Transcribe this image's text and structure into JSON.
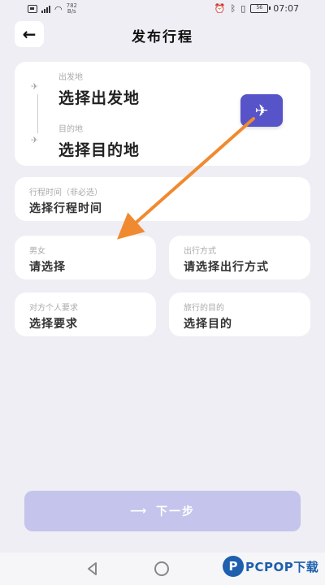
{
  "status_bar": {
    "network_speed": "782\nB/s",
    "time": "07:07",
    "battery": "56"
  },
  "header": {
    "back_glyph": "←",
    "title": "发布行程"
  },
  "route": {
    "from_label": "出发地",
    "from_value": "选择出发地",
    "to_label": "目的地",
    "to_value": "选择目的地"
  },
  "time": {
    "label": "行程时间（非必选）",
    "value": "选择行程时间"
  },
  "gender": {
    "label": "男女",
    "value": "请选择"
  },
  "travel_mode": {
    "label": "出行方式",
    "value": "请选择出行方式"
  },
  "requirement": {
    "label": "对方个人要求",
    "value": "选择要求"
  },
  "purpose": {
    "label": "旅行的目的",
    "value": "选择目的"
  },
  "next_button": {
    "label": "下一步"
  },
  "watermark": {
    "logo_letter": "P",
    "text": "PCPOP下载"
  },
  "colors": {
    "accent": "#5753c9",
    "button_disabled": "#c4c4ec",
    "annotation_arrow": "#f08a30",
    "background": "#eeeef4"
  },
  "icons": {
    "swap": "airplane-icon",
    "from": "takeoff-icon",
    "to": "landing-icon"
  }
}
